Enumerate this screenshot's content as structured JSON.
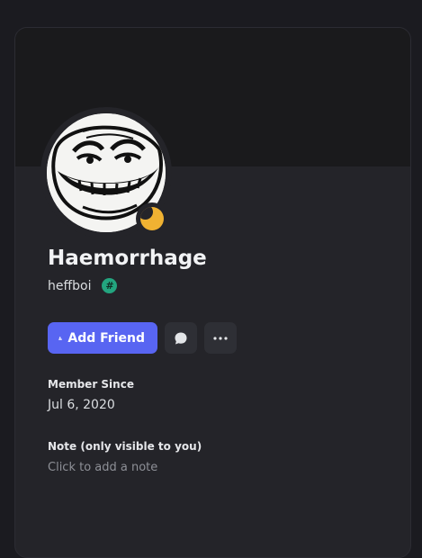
{
  "profile": {
    "display_name": "Haemorrhage",
    "username": "heffboi",
    "badge_symbol": "#",
    "avatar_icon": "troll-face-avatar",
    "status": "idle",
    "status_color": "#f0b232"
  },
  "actions": {
    "add_friend_label": "Add Friend",
    "add_friend_color": "#5865f2",
    "message_icon": "chat-bubble-icon",
    "more_icon": "more-dots-icon"
  },
  "member_since": {
    "label": "Member Since",
    "date": "Jul 6, 2020"
  },
  "note": {
    "label": "Note (only visible to you)",
    "placeholder": "Click to add a note"
  }
}
